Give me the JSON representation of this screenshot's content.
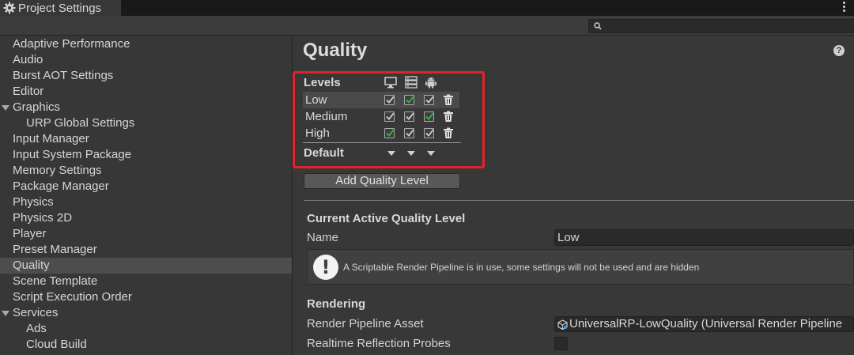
{
  "window": {
    "tab_title": "Project Settings"
  },
  "search": {
    "placeholder": ""
  },
  "sidebar": {
    "items": [
      {
        "label": "Adaptive Performance"
      },
      {
        "label": "Audio"
      },
      {
        "label": "Burst AOT Settings"
      },
      {
        "label": "Editor"
      },
      {
        "label": "Graphics"
      },
      {
        "label": "URP Global Settings"
      },
      {
        "label": "Input Manager"
      },
      {
        "label": "Input System Package"
      },
      {
        "label": "Memory Settings"
      },
      {
        "label": "Package Manager"
      },
      {
        "label": "Physics"
      },
      {
        "label": "Physics 2D"
      },
      {
        "label": "Player"
      },
      {
        "label": "Preset Manager"
      },
      {
        "label": "Quality"
      },
      {
        "label": "Scene Template"
      },
      {
        "label": "Script Execution Order"
      },
      {
        "label": "Services"
      },
      {
        "label": "Ads"
      },
      {
        "label": "Cloud Build"
      }
    ],
    "selected": "Quality"
  },
  "main": {
    "title": "Quality",
    "levels": {
      "header": "Levels",
      "platform_icons": [
        "monitor-icon",
        "server-icon",
        "android-icon"
      ],
      "rows": [
        {
          "name": "Low",
          "checks": [
            "checked",
            "default",
            "checked"
          ],
          "selected": true
        },
        {
          "name": "Medium",
          "checks": [
            "checked",
            "checked",
            "default"
          ],
          "selected": false
        },
        {
          "name": "High",
          "checks": [
            "default",
            "checked",
            "checked"
          ],
          "selected": false
        }
      ],
      "default_label": "Default"
    },
    "add_button": "Add Quality Level",
    "current_section": {
      "title": "Current Active Quality Level",
      "name_label": "Name",
      "name_value": "Low"
    },
    "helpbox_text": "A Scriptable Render Pipeline is in use, some settings will not be used and are hidden",
    "rendering": {
      "title": "Rendering",
      "pipeline_label": "Render Pipeline Asset",
      "pipeline_value": "UniversalRP-LowQuality (Universal Render Pipeline",
      "reflection_label": "Realtime Reflection Probes"
    }
  },
  "colors": {
    "highlight": "#e2232a",
    "default_check": "#2fbf3a",
    "background": "#383838"
  }
}
